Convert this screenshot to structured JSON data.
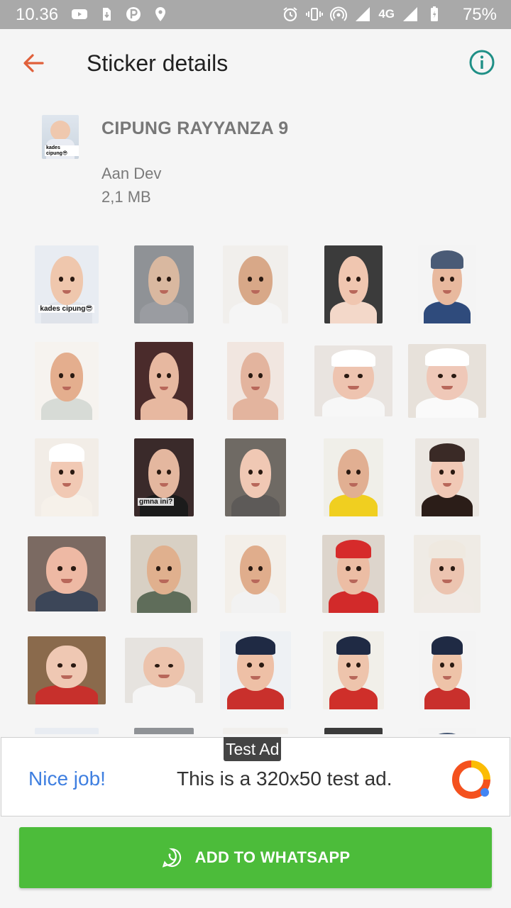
{
  "status_bar": {
    "time": "10.36",
    "network": "4G",
    "battery": "75%",
    "left_icons": [
      "youtube-icon",
      "download-icon",
      "parking-icon",
      "location-icon"
    ],
    "right_icons": [
      "alarm-icon",
      "vibrate-icon",
      "hotspot-icon",
      "signal-icon",
      "signal-icon"
    ]
  },
  "app_bar": {
    "title": "Sticker details",
    "back_icon": "arrow-left-icon",
    "info_icon": "info-icon",
    "accent_color": "#e0603a",
    "info_color": "#1f8f86"
  },
  "pack": {
    "name": "CIPUNG RAYYANZA 9",
    "publisher": "Aan Dev",
    "size": "2,1 MB",
    "tray_caption": "kades cipung😎"
  },
  "stickers": [
    {
      "caption": "kades cipung😎"
    },
    {
      "caption": ""
    },
    {
      "caption": ""
    },
    {
      "caption": ""
    },
    {
      "caption": ""
    },
    {
      "caption": ""
    },
    {
      "caption": ""
    },
    {
      "caption": ""
    },
    {
      "caption": ""
    },
    {
      "caption": ""
    },
    {
      "caption": ""
    },
    {
      "caption": "gmna ini?"
    },
    {
      "caption": ""
    },
    {
      "caption": ""
    },
    {
      "caption": ""
    },
    {
      "caption": ""
    },
    {
      "caption": ""
    },
    {
      "caption": ""
    },
    {
      "caption": ""
    },
    {
      "caption": ""
    },
    {
      "caption": ""
    },
    {
      "caption": ""
    },
    {
      "caption": ""
    },
    {
      "caption": ""
    },
    {
      "caption": ""
    }
  ],
  "ad": {
    "badge": "Test Ad",
    "headline": "Nice job!",
    "body": "This is a 320x50 test ad."
  },
  "add_button": {
    "label": "ADD TO WHATSAPP",
    "icon": "whatsapp-icon",
    "color": "#4cbc3a"
  }
}
